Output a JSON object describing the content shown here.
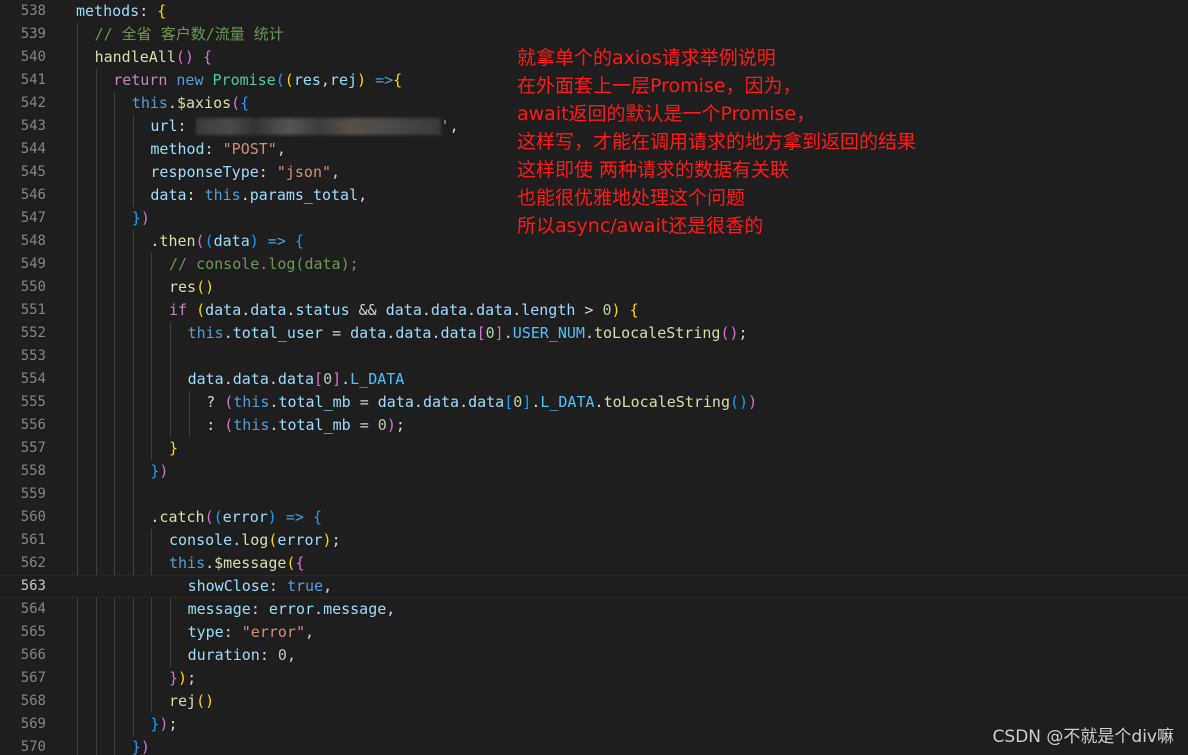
{
  "editor": {
    "lines": [
      {
        "ln": "538",
        "indent": 1,
        "tokens": [
          [
            "tk-var",
            "methods"
          ],
          [
            "tk-pun",
            ": "
          ],
          [
            "tk-br1",
            "{"
          ]
        ]
      },
      {
        "ln": "539",
        "indent": 2,
        "tokens": [
          [
            "tk-com",
            "// 全省 客户数/流量 统计"
          ]
        ]
      },
      {
        "ln": "540",
        "indent": 2,
        "tokens": [
          [
            "tk-fn",
            "handleAll"
          ],
          [
            "tk-br2",
            "()"
          ],
          [
            "tk-pun",
            " "
          ],
          [
            "tk-br2",
            "{"
          ]
        ]
      },
      {
        "ln": "541",
        "indent": 3,
        "tokens": [
          [
            "tk-ctl",
            "return"
          ],
          [
            "tk-pun",
            " "
          ],
          [
            "tk-kw",
            "new"
          ],
          [
            "tk-pun",
            " "
          ],
          [
            "tk-cls",
            "Promise"
          ],
          [
            "tk-br3",
            "("
          ],
          [
            "tk-br1",
            "("
          ],
          [
            "tk-var",
            "res"
          ],
          [
            "tk-pun",
            ","
          ],
          [
            "tk-var",
            "rej"
          ],
          [
            "tk-br1",
            ")"
          ],
          [
            "tk-pun",
            " "
          ],
          [
            "tk-kw",
            "=>"
          ],
          [
            "tk-br1",
            "{"
          ]
        ]
      },
      {
        "ln": "542",
        "indent": 4,
        "tokens": [
          [
            "tk-kw",
            "this"
          ],
          [
            "tk-pun",
            "."
          ],
          [
            "tk-fn",
            "$axios"
          ],
          [
            "tk-br2",
            "("
          ],
          [
            "tk-br3",
            "{"
          ]
        ]
      },
      {
        "ln": "543",
        "indent": 5,
        "tokens": [
          [
            "tk-var",
            "url"
          ],
          [
            "tk-pun",
            ": "
          ],
          [
            "blur",
            ""
          ],
          [
            "tk-str",
            "'"
          ],
          [
            "tk-pun",
            ","
          ]
        ]
      },
      {
        "ln": "544",
        "indent": 5,
        "tokens": [
          [
            "tk-var",
            "method"
          ],
          [
            "tk-pun",
            ": "
          ],
          [
            "tk-str",
            "\"POST\""
          ],
          [
            "tk-pun",
            ","
          ]
        ]
      },
      {
        "ln": "545",
        "indent": 5,
        "tokens": [
          [
            "tk-var",
            "responseType"
          ],
          [
            "tk-pun",
            ": "
          ],
          [
            "tk-str",
            "\"json\""
          ],
          [
            "tk-pun",
            ","
          ]
        ]
      },
      {
        "ln": "546",
        "indent": 5,
        "tokens": [
          [
            "tk-var",
            "data"
          ],
          [
            "tk-pun",
            ": "
          ],
          [
            "tk-kw",
            "this"
          ],
          [
            "tk-pun",
            "."
          ],
          [
            "tk-var",
            "params_total"
          ],
          [
            "tk-pun",
            ","
          ]
        ]
      },
      {
        "ln": "547",
        "indent": 4,
        "tokens": [
          [
            "tk-br3",
            "}"
          ],
          [
            "tk-br2",
            ")"
          ]
        ]
      },
      {
        "ln": "548",
        "indent": 5,
        "tokens": [
          [
            "tk-pun",
            "."
          ],
          [
            "tk-fn",
            "then"
          ],
          [
            "tk-br2",
            "("
          ],
          [
            "tk-br3",
            "("
          ],
          [
            "tk-var",
            "data"
          ],
          [
            "tk-br3",
            ")"
          ],
          [
            "tk-pun",
            " "
          ],
          [
            "tk-kw",
            "=>"
          ],
          [
            "tk-pun",
            " "
          ],
          [
            "tk-br3",
            "{"
          ]
        ]
      },
      {
        "ln": "549",
        "indent": 6,
        "tokens": [
          [
            "tk-com",
            "// console.log(data);"
          ]
        ]
      },
      {
        "ln": "550",
        "indent": 6,
        "tokens": [
          [
            "tk-fn",
            "res"
          ],
          [
            "tk-br1",
            "()"
          ]
        ]
      },
      {
        "ln": "551",
        "indent": 6,
        "tokens": [
          [
            "tk-ctl",
            "if"
          ],
          [
            "tk-pun",
            " "
          ],
          [
            "tk-br1",
            "("
          ],
          [
            "tk-var",
            "data"
          ],
          [
            "tk-pun",
            "."
          ],
          [
            "tk-var",
            "data"
          ],
          [
            "tk-pun",
            "."
          ],
          [
            "tk-var",
            "status"
          ],
          [
            "tk-pun",
            " && "
          ],
          [
            "tk-var",
            "data"
          ],
          [
            "tk-pun",
            "."
          ],
          [
            "tk-var",
            "data"
          ],
          [
            "tk-pun",
            "."
          ],
          [
            "tk-var",
            "data"
          ],
          [
            "tk-pun",
            "."
          ],
          [
            "tk-var",
            "length"
          ],
          [
            "tk-pun",
            " > "
          ],
          [
            "tk-num",
            "0"
          ],
          [
            "tk-br1",
            ")"
          ],
          [
            "tk-pun",
            " "
          ],
          [
            "tk-br1",
            "{"
          ]
        ]
      },
      {
        "ln": "552",
        "indent": 7,
        "tokens": [
          [
            "tk-kw",
            "this"
          ],
          [
            "tk-pun",
            "."
          ],
          [
            "tk-var",
            "total_user"
          ],
          [
            "tk-pun",
            " = "
          ],
          [
            "tk-var",
            "data"
          ],
          [
            "tk-pun",
            "."
          ],
          [
            "tk-var",
            "data"
          ],
          [
            "tk-pun",
            "."
          ],
          [
            "tk-var",
            "data"
          ],
          [
            "tk-br2",
            "["
          ],
          [
            "tk-num",
            "0"
          ],
          [
            "tk-br2",
            "]"
          ],
          [
            "tk-pun",
            "."
          ],
          [
            "tk-const",
            "USER_NUM"
          ],
          [
            "tk-pun",
            "."
          ],
          [
            "tk-fn",
            "toLocaleString"
          ],
          [
            "tk-br2",
            "()"
          ],
          [
            "tk-pun",
            ";"
          ]
        ]
      },
      {
        "ln": "553",
        "indent": 7,
        "tokens": []
      },
      {
        "ln": "554",
        "indent": 7,
        "tokens": [
          [
            "tk-var",
            "data"
          ],
          [
            "tk-pun",
            "."
          ],
          [
            "tk-var",
            "data"
          ],
          [
            "tk-pun",
            "."
          ],
          [
            "tk-var",
            "data"
          ],
          [
            "tk-br2",
            "["
          ],
          [
            "tk-num",
            "0"
          ],
          [
            "tk-br2",
            "]"
          ],
          [
            "tk-pun",
            "."
          ],
          [
            "tk-const",
            "L_DATA"
          ]
        ]
      },
      {
        "ln": "555",
        "indent": 8,
        "tokens": [
          [
            "tk-pun",
            "? "
          ],
          [
            "tk-br2",
            "("
          ],
          [
            "tk-kw",
            "this"
          ],
          [
            "tk-pun",
            "."
          ],
          [
            "tk-var",
            "total_mb"
          ],
          [
            "tk-pun",
            " = "
          ],
          [
            "tk-var",
            "data"
          ],
          [
            "tk-pun",
            "."
          ],
          [
            "tk-var",
            "data"
          ],
          [
            "tk-pun",
            "."
          ],
          [
            "tk-var",
            "data"
          ],
          [
            "tk-br3",
            "["
          ],
          [
            "tk-num",
            "0"
          ],
          [
            "tk-br3",
            "]"
          ],
          [
            "tk-pun",
            "."
          ],
          [
            "tk-const",
            "L_DATA"
          ],
          [
            "tk-pun",
            "."
          ],
          [
            "tk-fn",
            "toLocaleString"
          ],
          [
            "tk-br3",
            "()"
          ],
          [
            "tk-br2",
            ")"
          ]
        ]
      },
      {
        "ln": "556",
        "indent": 8,
        "tokens": [
          [
            "tk-pun",
            ": "
          ],
          [
            "tk-br2",
            "("
          ],
          [
            "tk-kw",
            "this"
          ],
          [
            "tk-pun",
            "."
          ],
          [
            "tk-var",
            "total_mb"
          ],
          [
            "tk-pun",
            " = "
          ],
          [
            "tk-num",
            "0"
          ],
          [
            "tk-br2",
            ")"
          ],
          [
            "tk-pun",
            ";"
          ]
        ]
      },
      {
        "ln": "557",
        "indent": 6,
        "tokens": [
          [
            "tk-br1",
            "}"
          ]
        ]
      },
      {
        "ln": "558",
        "indent": 5,
        "tokens": [
          [
            "tk-br3",
            "}"
          ],
          [
            "tk-br2",
            ")"
          ]
        ]
      },
      {
        "ln": "559",
        "indent": 5,
        "tokens": []
      },
      {
        "ln": "560",
        "indent": 5,
        "tokens": [
          [
            "tk-pun",
            "."
          ],
          [
            "tk-fn",
            "catch"
          ],
          [
            "tk-br2",
            "("
          ],
          [
            "tk-br3",
            "("
          ],
          [
            "tk-var",
            "error"
          ],
          [
            "tk-br3",
            ")"
          ],
          [
            "tk-pun",
            " "
          ],
          [
            "tk-kw",
            "=>"
          ],
          [
            "tk-pun",
            " "
          ],
          [
            "tk-br3",
            "{"
          ]
        ]
      },
      {
        "ln": "561",
        "indent": 6,
        "tokens": [
          [
            "tk-var",
            "console"
          ],
          [
            "tk-pun",
            "."
          ],
          [
            "tk-fn",
            "log"
          ],
          [
            "tk-br1",
            "("
          ],
          [
            "tk-var",
            "error"
          ],
          [
            "tk-br1",
            ")"
          ],
          [
            "tk-pun",
            ";"
          ]
        ]
      },
      {
        "ln": "562",
        "indent": 6,
        "tokens": [
          [
            "tk-kw",
            "this"
          ],
          [
            "tk-pun",
            "."
          ],
          [
            "tk-fn",
            "$message"
          ],
          [
            "tk-br1",
            "("
          ],
          [
            "tk-br2",
            "{"
          ]
        ]
      },
      {
        "ln": "563",
        "indent": 7,
        "tokens": [
          [
            "tk-var",
            "showClose"
          ],
          [
            "tk-pun",
            ": "
          ],
          [
            "tk-kw",
            "true"
          ],
          [
            "tk-pun",
            ","
          ]
        ]
      },
      {
        "ln": "564",
        "indent": 7,
        "tokens": [
          [
            "tk-var",
            "message"
          ],
          [
            "tk-pun",
            ": "
          ],
          [
            "tk-var",
            "error"
          ],
          [
            "tk-pun",
            "."
          ],
          [
            "tk-var",
            "message"
          ],
          [
            "tk-pun",
            ","
          ]
        ]
      },
      {
        "ln": "565",
        "indent": 7,
        "tokens": [
          [
            "tk-var",
            "type"
          ],
          [
            "tk-pun",
            ": "
          ],
          [
            "tk-str",
            "\"error\""
          ],
          [
            "tk-pun",
            ","
          ]
        ]
      },
      {
        "ln": "566",
        "indent": 7,
        "tokens": [
          [
            "tk-var",
            "duration"
          ],
          [
            "tk-pun",
            ": "
          ],
          [
            "tk-num",
            "0"
          ],
          [
            "tk-pun",
            ","
          ]
        ]
      },
      {
        "ln": "567",
        "indent": 6,
        "tokens": [
          [
            "tk-br2",
            "}"
          ],
          [
            "tk-br1",
            ")"
          ],
          [
            "tk-pun",
            ";"
          ]
        ]
      },
      {
        "ln": "568",
        "indent": 6,
        "tokens": [
          [
            "tk-fn",
            "rej"
          ],
          [
            "tk-br1",
            "()"
          ]
        ]
      },
      {
        "ln": "569",
        "indent": 5,
        "tokens": [
          [
            "tk-br3",
            "}"
          ],
          [
            "tk-br2",
            ")"
          ],
          [
            "tk-pun",
            ";"
          ]
        ]
      },
      {
        "ln": "570",
        "indent": 4,
        "tokens": [
          [
            "tk-br3",
            "}"
          ],
          [
            "tk-br2",
            ")"
          ]
        ]
      }
    ],
    "current_line": "563"
  },
  "annotation": {
    "lines": [
      "就拿单个的axios请求举例说明",
      "在外面套上一层Promise，因为，",
      "await返回的默认是一个Promise，",
      "这样写，才能在调用请求的地方拿到返回的结果",
      "这样即使  两种请求的数据有关联",
      "也能很优雅地处理这个问题",
      "所以async/await还是很香的"
    ]
  },
  "watermark": "CSDN @不就是个div嘛",
  "colors": {
    "background": "#1e1e1e",
    "line_number": "#858585",
    "annotation": "#ff1a1a"
  }
}
